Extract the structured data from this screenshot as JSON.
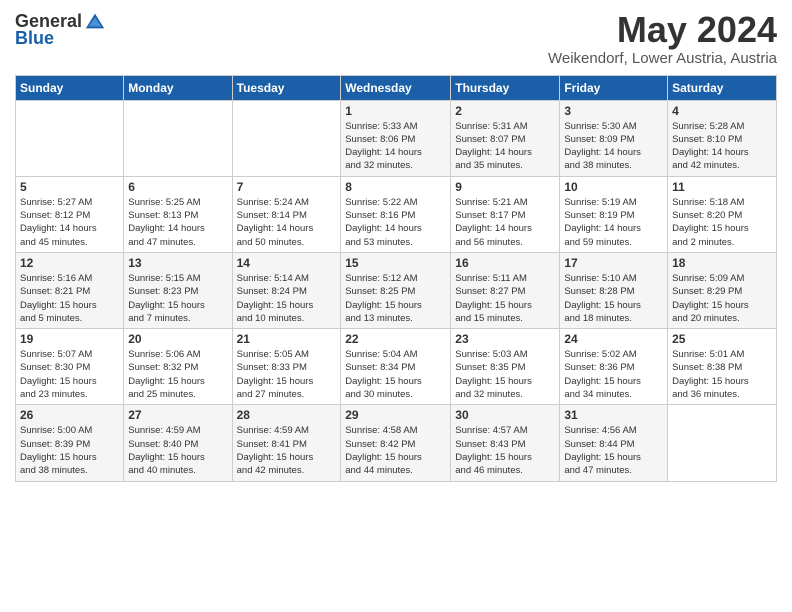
{
  "logo": {
    "general": "General",
    "blue": "Blue"
  },
  "title": "May 2024",
  "location": "Weikendorf, Lower Austria, Austria",
  "headers": [
    "Sunday",
    "Monday",
    "Tuesday",
    "Wednesday",
    "Thursday",
    "Friday",
    "Saturday"
  ],
  "weeks": [
    [
      {
        "num": "",
        "info": ""
      },
      {
        "num": "",
        "info": ""
      },
      {
        "num": "",
        "info": ""
      },
      {
        "num": "1",
        "info": "Sunrise: 5:33 AM\nSunset: 8:06 PM\nDaylight: 14 hours\nand 32 minutes."
      },
      {
        "num": "2",
        "info": "Sunrise: 5:31 AM\nSunset: 8:07 PM\nDaylight: 14 hours\nand 35 minutes."
      },
      {
        "num": "3",
        "info": "Sunrise: 5:30 AM\nSunset: 8:09 PM\nDaylight: 14 hours\nand 38 minutes."
      },
      {
        "num": "4",
        "info": "Sunrise: 5:28 AM\nSunset: 8:10 PM\nDaylight: 14 hours\nand 42 minutes."
      }
    ],
    [
      {
        "num": "5",
        "info": "Sunrise: 5:27 AM\nSunset: 8:12 PM\nDaylight: 14 hours\nand 45 minutes."
      },
      {
        "num": "6",
        "info": "Sunrise: 5:25 AM\nSunset: 8:13 PM\nDaylight: 14 hours\nand 47 minutes."
      },
      {
        "num": "7",
        "info": "Sunrise: 5:24 AM\nSunset: 8:14 PM\nDaylight: 14 hours\nand 50 minutes."
      },
      {
        "num": "8",
        "info": "Sunrise: 5:22 AM\nSunset: 8:16 PM\nDaylight: 14 hours\nand 53 minutes."
      },
      {
        "num": "9",
        "info": "Sunrise: 5:21 AM\nSunset: 8:17 PM\nDaylight: 14 hours\nand 56 minutes."
      },
      {
        "num": "10",
        "info": "Sunrise: 5:19 AM\nSunset: 8:19 PM\nDaylight: 14 hours\nand 59 minutes."
      },
      {
        "num": "11",
        "info": "Sunrise: 5:18 AM\nSunset: 8:20 PM\nDaylight: 15 hours\nand 2 minutes."
      }
    ],
    [
      {
        "num": "12",
        "info": "Sunrise: 5:16 AM\nSunset: 8:21 PM\nDaylight: 15 hours\nand 5 minutes."
      },
      {
        "num": "13",
        "info": "Sunrise: 5:15 AM\nSunset: 8:23 PM\nDaylight: 15 hours\nand 7 minutes."
      },
      {
        "num": "14",
        "info": "Sunrise: 5:14 AM\nSunset: 8:24 PM\nDaylight: 15 hours\nand 10 minutes."
      },
      {
        "num": "15",
        "info": "Sunrise: 5:12 AM\nSunset: 8:25 PM\nDaylight: 15 hours\nand 13 minutes."
      },
      {
        "num": "16",
        "info": "Sunrise: 5:11 AM\nSunset: 8:27 PM\nDaylight: 15 hours\nand 15 minutes."
      },
      {
        "num": "17",
        "info": "Sunrise: 5:10 AM\nSunset: 8:28 PM\nDaylight: 15 hours\nand 18 minutes."
      },
      {
        "num": "18",
        "info": "Sunrise: 5:09 AM\nSunset: 8:29 PM\nDaylight: 15 hours\nand 20 minutes."
      }
    ],
    [
      {
        "num": "19",
        "info": "Sunrise: 5:07 AM\nSunset: 8:30 PM\nDaylight: 15 hours\nand 23 minutes."
      },
      {
        "num": "20",
        "info": "Sunrise: 5:06 AM\nSunset: 8:32 PM\nDaylight: 15 hours\nand 25 minutes."
      },
      {
        "num": "21",
        "info": "Sunrise: 5:05 AM\nSunset: 8:33 PM\nDaylight: 15 hours\nand 27 minutes."
      },
      {
        "num": "22",
        "info": "Sunrise: 5:04 AM\nSunset: 8:34 PM\nDaylight: 15 hours\nand 30 minutes."
      },
      {
        "num": "23",
        "info": "Sunrise: 5:03 AM\nSunset: 8:35 PM\nDaylight: 15 hours\nand 32 minutes."
      },
      {
        "num": "24",
        "info": "Sunrise: 5:02 AM\nSunset: 8:36 PM\nDaylight: 15 hours\nand 34 minutes."
      },
      {
        "num": "25",
        "info": "Sunrise: 5:01 AM\nSunset: 8:38 PM\nDaylight: 15 hours\nand 36 minutes."
      }
    ],
    [
      {
        "num": "26",
        "info": "Sunrise: 5:00 AM\nSunset: 8:39 PM\nDaylight: 15 hours\nand 38 minutes."
      },
      {
        "num": "27",
        "info": "Sunrise: 4:59 AM\nSunset: 8:40 PM\nDaylight: 15 hours\nand 40 minutes."
      },
      {
        "num": "28",
        "info": "Sunrise: 4:59 AM\nSunset: 8:41 PM\nDaylight: 15 hours\nand 42 minutes."
      },
      {
        "num": "29",
        "info": "Sunrise: 4:58 AM\nSunset: 8:42 PM\nDaylight: 15 hours\nand 44 minutes."
      },
      {
        "num": "30",
        "info": "Sunrise: 4:57 AM\nSunset: 8:43 PM\nDaylight: 15 hours\nand 46 minutes."
      },
      {
        "num": "31",
        "info": "Sunrise: 4:56 AM\nSunset: 8:44 PM\nDaylight: 15 hours\nand 47 minutes."
      },
      {
        "num": "",
        "info": ""
      }
    ]
  ]
}
